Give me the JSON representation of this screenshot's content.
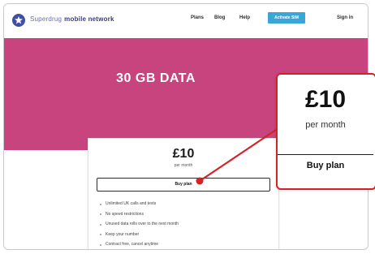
{
  "header": {
    "brand_name": "Superdrug",
    "brand_sub": "mobile network",
    "nav": [
      "Plans",
      "Blog",
      "Help"
    ],
    "cta_label": "Activate SIM",
    "sign_in": "Sign in"
  },
  "hero": {
    "title": "30 GB DATA"
  },
  "plan": {
    "price": "£10",
    "per_month": "per month",
    "buy_label": "Buy plan",
    "features": [
      "Unlimited UK calls and texts",
      "No speed restrictions",
      "Unused data rolls over to the next month",
      "Keep your number",
      "Contract free, cancel anytime"
    ]
  },
  "callout": {
    "price": "£10",
    "per_month": "per month",
    "buy_label": "Buy plan"
  },
  "colors": {
    "hero": "#c8447e",
    "accent": "#d3232a",
    "cta": "#3aa6d8",
    "brand": "#3f4fa4"
  }
}
